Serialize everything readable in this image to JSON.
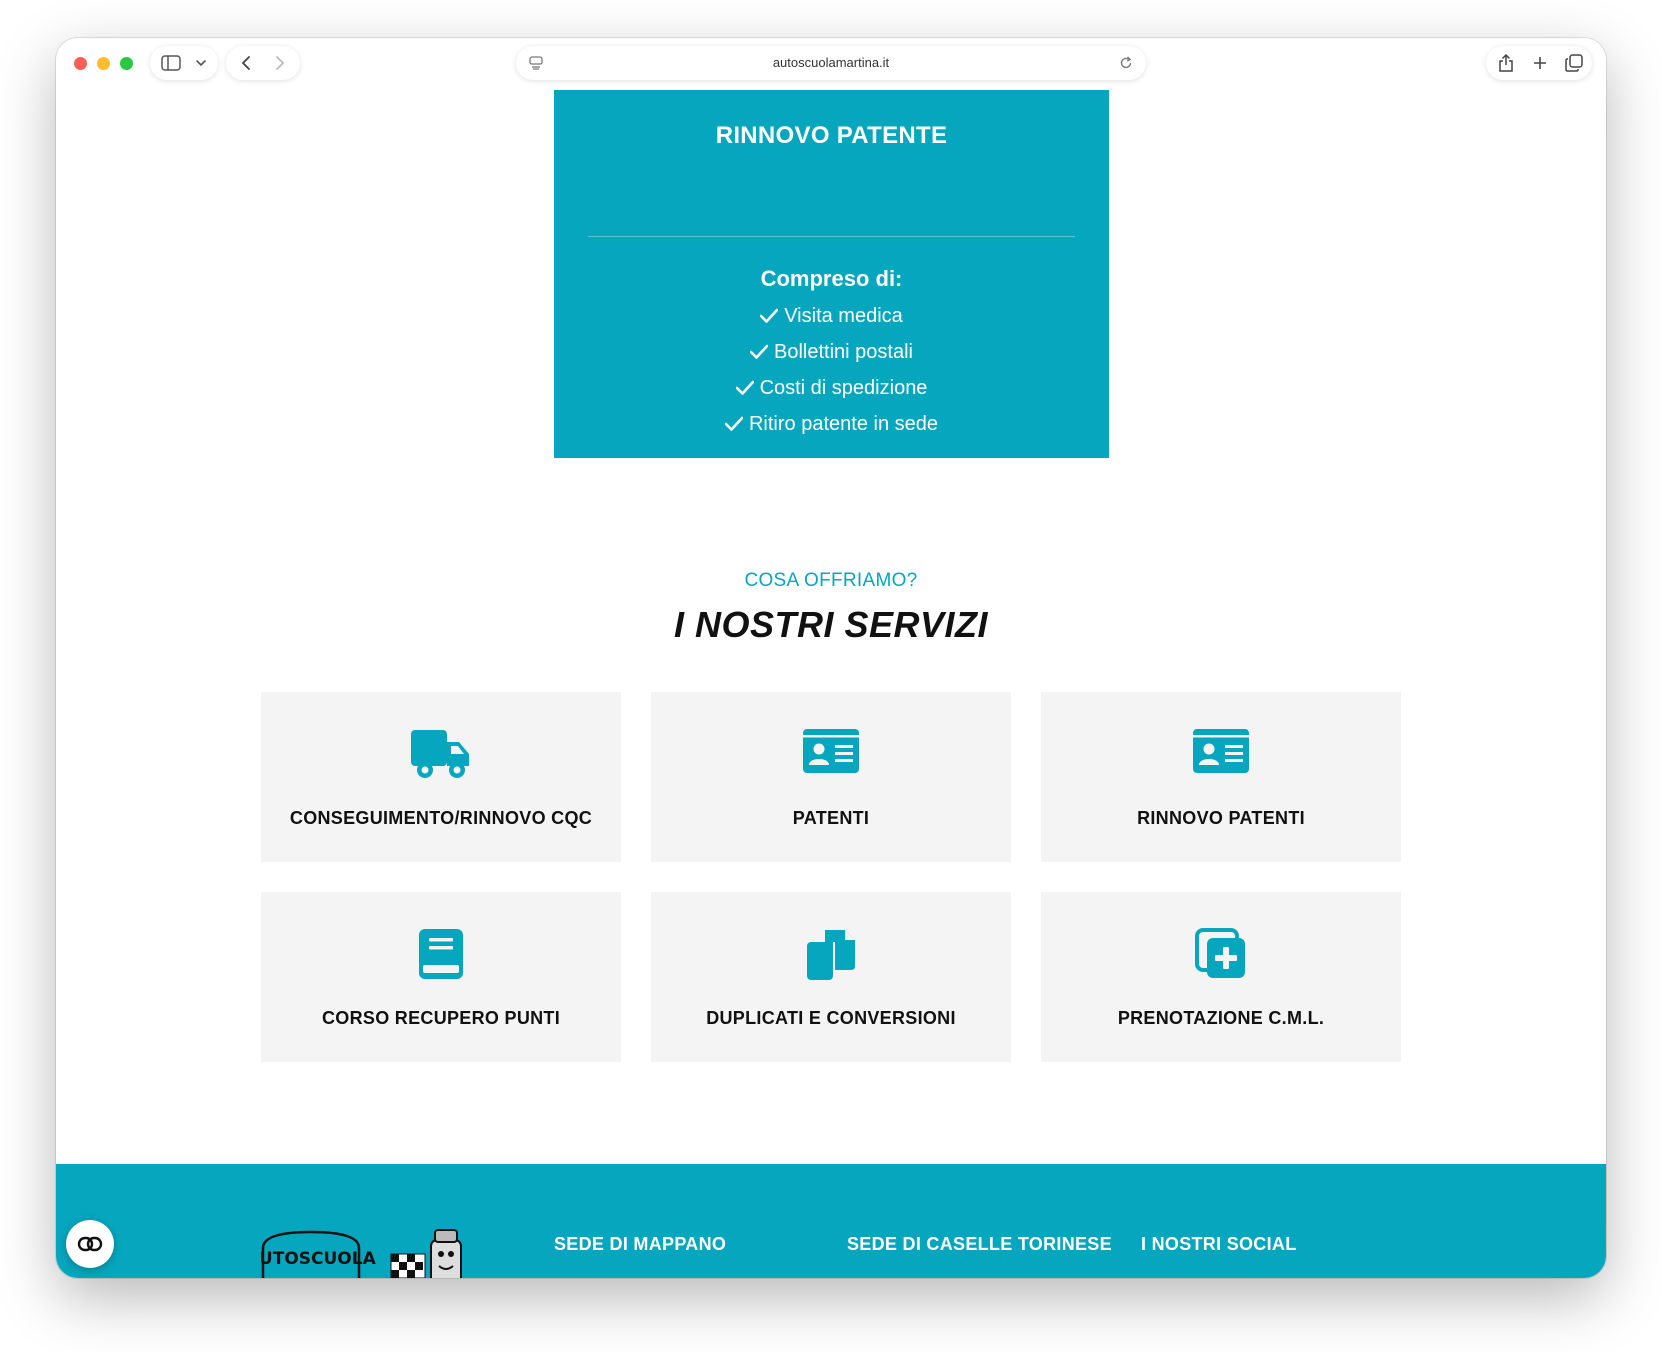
{
  "browser": {
    "url": "autoscuolamartina.it"
  },
  "price_card": {
    "title": "RINNOVO PATENTE",
    "included_label": "Compreso di:",
    "items": [
      "Visita medica",
      "Bollettini postali",
      "Costi di spedizione",
      "Ritiro patente in sede"
    ]
  },
  "services": {
    "eyebrow": "COSA OFFRIAMO?",
    "title": "I NOSTRI SERVIZI",
    "items": [
      {
        "label": "CONSEGUIMENTO/RINNOVO CQC",
        "icon": "truck-icon"
      },
      {
        "label": "PATENTI",
        "icon": "id-card-icon"
      },
      {
        "label": "RINNOVO PATENTI",
        "icon": "id-card-icon"
      },
      {
        "label": "CORSO RECUPERO PUNTI",
        "icon": "book-icon"
      },
      {
        "label": "DUPLICATI E CONVERSIONI",
        "icon": "copy-icon"
      },
      {
        "label": "PRENOTAZIONE C.M.L.",
        "icon": "medical-plus-icon"
      }
    ]
  },
  "footer": {
    "columns": [
      "SEDE DI MAPPANO",
      "SEDE DI CASELLE TORINESE",
      "I NOSTRI SOCIAL"
    ],
    "logo_text": "AUTOSCUOLA"
  },
  "colors": {
    "accent": "#06a6be",
    "card_bg": "#f4f4f4",
    "text_dark": "#111111"
  }
}
